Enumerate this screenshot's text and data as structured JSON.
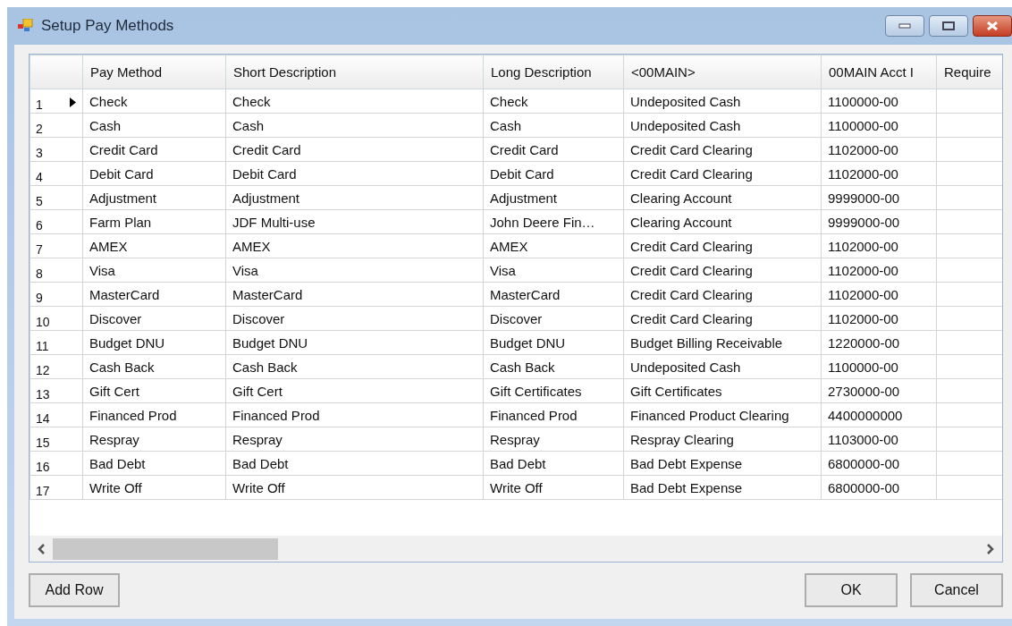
{
  "window": {
    "title": "Setup Pay Methods"
  },
  "table": {
    "columns": [
      "Pay Method",
      "Short Description",
      "Long Description",
      "<00MAIN>",
      "00MAIN Acct I",
      "Require"
    ],
    "rows": [
      {
        "number": "1",
        "current": true,
        "cells": [
          "Check",
          "Check",
          "Check",
          "Undeposited Cash",
          "1100000-00",
          ""
        ]
      },
      {
        "number": "2",
        "current": false,
        "cells": [
          "Cash",
          "Cash",
          "Cash",
          "Undeposited Cash",
          "1100000-00",
          ""
        ]
      },
      {
        "number": "3",
        "current": false,
        "cells": [
          "Credit Card",
          "Credit Card",
          "Credit Card",
          "Credit Card Clearing",
          "1102000-00",
          ""
        ]
      },
      {
        "number": "4",
        "current": false,
        "cells": [
          "Debit Card",
          "Debit Card",
          "Debit Card",
          "Credit Card Clearing",
          "1102000-00",
          ""
        ]
      },
      {
        "number": "5",
        "current": false,
        "cells": [
          "Adjustment",
          "Adjustment",
          "Adjustment",
          "Clearing Account",
          "9999000-00",
          ""
        ]
      },
      {
        "number": "6",
        "current": false,
        "cells": [
          "Farm Plan",
          "JDF Multi-use",
          "John Deere Fin…",
          "Clearing Account",
          "9999000-00",
          ""
        ]
      },
      {
        "number": "7",
        "current": false,
        "cells": [
          "AMEX",
          "AMEX",
          "AMEX",
          "Credit Card Clearing",
          "1102000-00",
          ""
        ]
      },
      {
        "number": "8",
        "current": false,
        "cells": [
          "Visa",
          "Visa",
          "Visa",
          "Credit Card Clearing",
          "1102000-00",
          ""
        ]
      },
      {
        "number": "9",
        "current": false,
        "cells": [
          "MasterCard",
          "MasterCard",
          "MasterCard",
          "Credit Card Clearing",
          "1102000-00",
          ""
        ]
      },
      {
        "number": "10",
        "current": false,
        "cells": [
          "Discover",
          "Discover",
          "Discover",
          "Credit Card Clearing",
          "1102000-00",
          ""
        ]
      },
      {
        "number": "11",
        "current": false,
        "cells": [
          "Budget DNU",
          "Budget DNU",
          "Budget DNU",
          "Budget Billing Receivable",
          "1220000-00",
          ""
        ]
      },
      {
        "number": "12",
        "current": false,
        "cells": [
          "Cash Back",
          "Cash Back",
          "Cash Back",
          "Undeposited Cash",
          "1100000-00",
          ""
        ]
      },
      {
        "number": "13",
        "current": false,
        "cells": [
          "Gift Cert",
          "Gift Cert",
          "Gift Certificates",
          "Gift Certificates",
          "2730000-00",
          ""
        ]
      },
      {
        "number": "14",
        "current": false,
        "cells": [
          "Financed Prod",
          "Financed Prod",
          "Financed Prod",
          "Financed Product Clearing",
          "4400000000",
          ""
        ]
      },
      {
        "number": "15",
        "current": false,
        "cells": [
          "Respray",
          "Respray",
          "Respray",
          "Respray Clearing",
          "1103000-00",
          ""
        ]
      },
      {
        "number": "16",
        "current": false,
        "cells": [
          "Bad Debt",
          "Bad Debt",
          "Bad Debt",
          "Bad Debt Expense",
          "6800000-00",
          ""
        ]
      },
      {
        "number": "17",
        "current": false,
        "cells": [
          "Write Off",
          "Write Off",
          "Write Off",
          "Bad Debt Expense",
          "6800000-00",
          ""
        ]
      }
    ]
  },
  "buttons": {
    "left": [
      "Add Row"
    ],
    "right": [
      "OK",
      "Cancel"
    ]
  }
}
